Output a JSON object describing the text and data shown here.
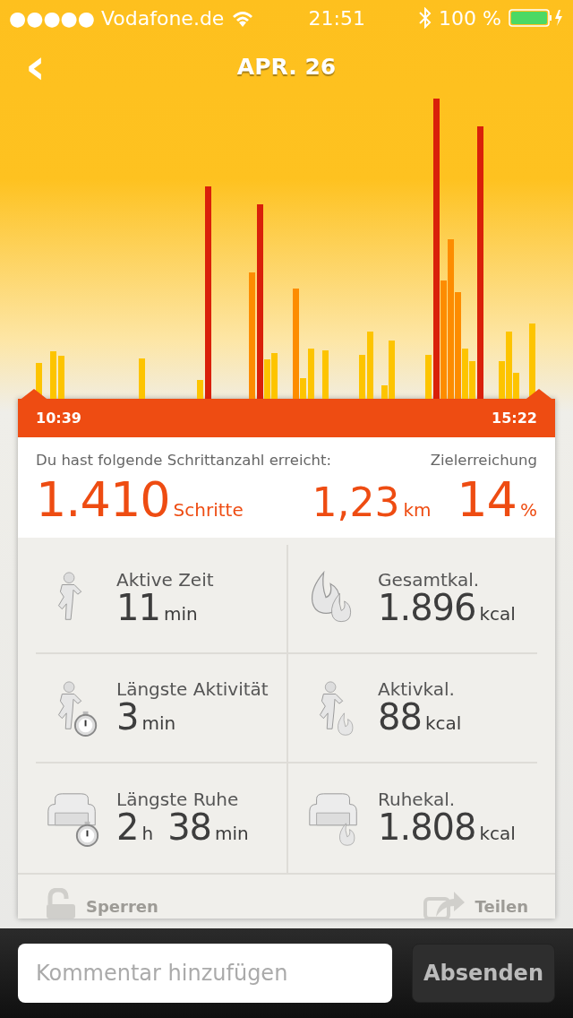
{
  "status_bar": {
    "carrier": "●●●●● Vodafone.de",
    "time": "21:51",
    "battery": "100 %"
  },
  "header": {
    "back": "‹",
    "title": "APR. 26"
  },
  "timeline": {
    "start": "10:39",
    "end": "15:22"
  },
  "summary": {
    "label": "Du hast folgende Schrittanzahl erreicht:",
    "goal_label": "Zielerreichung",
    "steps": "1.410",
    "steps_unit": "Schritte",
    "distance": "1,23",
    "distance_unit": "km",
    "goal": "14",
    "goal_unit": "%"
  },
  "stats": [
    {
      "kind": "active-time",
      "label": "Aktive Zeit",
      "parts": [
        {
          "number": "11",
          "unit": "min"
        }
      ]
    },
    {
      "kind": "total-calories",
      "label": "Gesamtkal.",
      "parts": [
        {
          "number": "1.896",
          "unit": "kcal"
        }
      ]
    },
    {
      "kind": "longest-activity",
      "label": "Längste Aktivität",
      "parts": [
        {
          "number": "3",
          "unit": "min"
        }
      ]
    },
    {
      "kind": "active-calories",
      "label": "Aktivkal.",
      "parts": [
        {
          "number": "88",
          "unit": "kcal"
        }
      ]
    },
    {
      "kind": "longest-rest",
      "label": "Längste Ruhe",
      "parts": [
        {
          "number": "2",
          "unit": "h"
        },
        {
          "number": "38",
          "unit": "min"
        }
      ]
    },
    {
      "kind": "rest-calories",
      "label": "Ruhekal.",
      "parts": [
        {
          "number": "1.808",
          "unit": "kcal"
        }
      ]
    }
  ],
  "actions": [
    {
      "kind": "lock",
      "label": "Sperren"
    },
    {
      "kind": "share",
      "label": "Teilen"
    }
  ],
  "comment": {
    "placeholder": "Kommentar hinzufügen",
    "button": "Absenden"
  }
}
